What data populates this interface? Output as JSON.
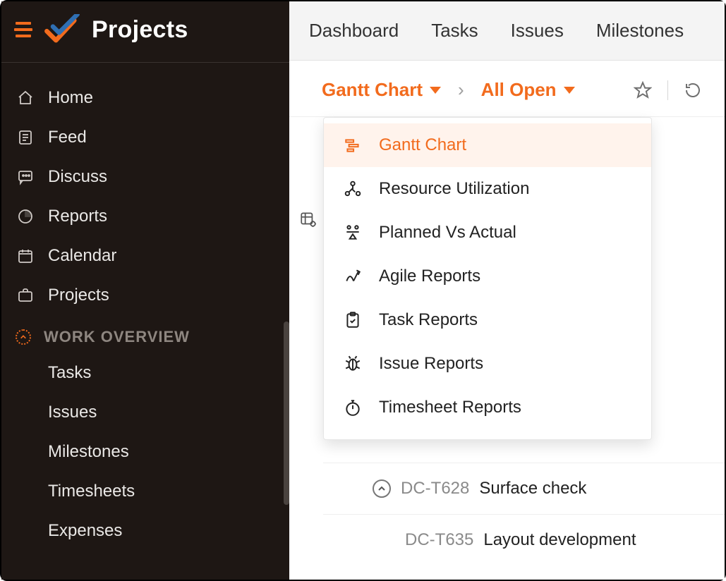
{
  "app": {
    "title": "Projects"
  },
  "sidebar": {
    "items": [
      {
        "label": "Home"
      },
      {
        "label": "Feed"
      },
      {
        "label": "Discuss"
      },
      {
        "label": "Reports"
      },
      {
        "label": "Calendar"
      },
      {
        "label": "Projects"
      }
    ],
    "section": {
      "label": "WORK OVERVIEW"
    },
    "subitems": [
      {
        "label": "Tasks"
      },
      {
        "label": "Issues"
      },
      {
        "label": "Milestones"
      },
      {
        "label": "Timesheets"
      },
      {
        "label": "Expenses"
      }
    ]
  },
  "topbar": {
    "tabs": [
      {
        "label": "Dashboard"
      },
      {
        "label": "Tasks"
      },
      {
        "label": "Issues"
      },
      {
        "label": "Milestones"
      }
    ]
  },
  "toolbar": {
    "view_label": "Gantt Chart",
    "filter_label": "All Open"
  },
  "menu": {
    "items": [
      {
        "label": "Gantt Chart",
        "active": true
      },
      {
        "label": "Resource Utilization"
      },
      {
        "label": "Planned Vs Actual"
      },
      {
        "label": "Agile Reports"
      },
      {
        "label": "Task Reports"
      },
      {
        "label": "Issue Reports"
      },
      {
        "label": "Timesheet Reports"
      }
    ]
  },
  "rows": [
    {
      "code": "DC-T628",
      "title": "Surface check",
      "collapsible": true
    },
    {
      "code": "DC-T635",
      "title": "Layout development",
      "collapsible": false
    }
  ]
}
